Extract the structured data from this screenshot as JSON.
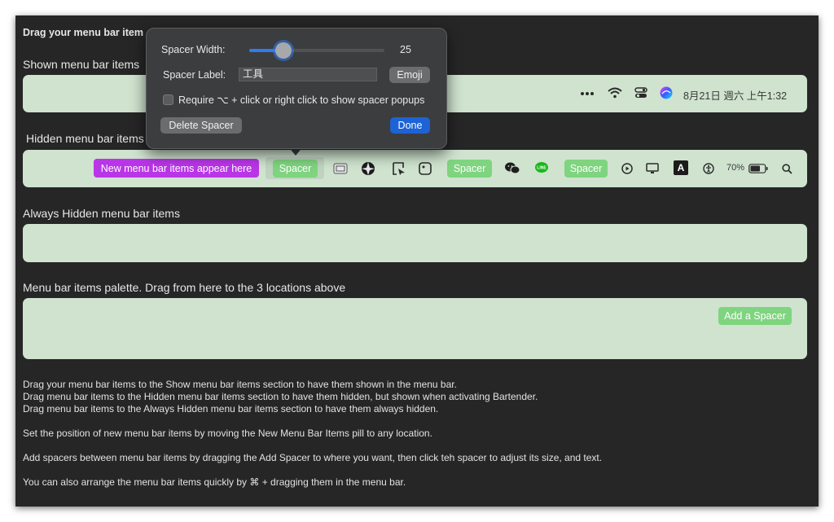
{
  "window": {
    "title_bar_text": "Drag your menu bar item"
  },
  "sections": {
    "shown": {
      "heading": "Shown menu bar items"
    },
    "hidden": {
      "heading": "Hidden menu bar items"
    },
    "always_hidden": {
      "heading": "Always Hidden menu bar items"
    },
    "palette": {
      "heading": "Menu bar items palette. Drag from here to the 3 locations above"
    }
  },
  "shown_items": {
    "datetime": "8月21日 週六 上午1:32"
  },
  "hidden_items": {
    "new_items_pill": "New menu bar items appear here",
    "spacer_labels": [
      "Spacer",
      "Spacer",
      "Spacer"
    ],
    "battery_percent": "70%",
    "font_icon_letter": "A"
  },
  "palette": {
    "add_spacer_label": "Add a Spacer"
  },
  "popup": {
    "width_label": "Spacer Width:",
    "width_value": "25",
    "width_min": 0,
    "width_max": 100,
    "label_label": "Spacer Label:",
    "label_value": "工具",
    "emoji_button": "Emoji",
    "checkbox_label": "Require ⌥ + click or right click to show spacer popups",
    "checkbox_checked": false,
    "delete_button": "Delete Spacer",
    "done_button": "Done"
  },
  "help_text": [
    "Drag your menu bar items to the Show menu bar items section to have them shown in the menu bar.",
    "Drag menu bar items to the Hidden menu bar items section to have them hidden, but shown when activating Bartender.",
    "Drag menu bar items to the Always Hidden menu bar items section to have them always hidden.",
    "Set the position of new menu bar items by moving the New Menu Bar Items pill to any location.",
    "Add spacers between menu bar items by dragging the Add Spacer to where you want, then click teh spacer to adjust its size, and text.",
    "You can also arrange the menu bar items quickly by ⌘ + dragging them in the menu bar."
  ],
  "colors": {
    "zone_bg": "#cfe3cf",
    "spacer_green": "#7fd47f",
    "new_items_purple": "#b935e8",
    "done_blue": "#1e63d6"
  }
}
